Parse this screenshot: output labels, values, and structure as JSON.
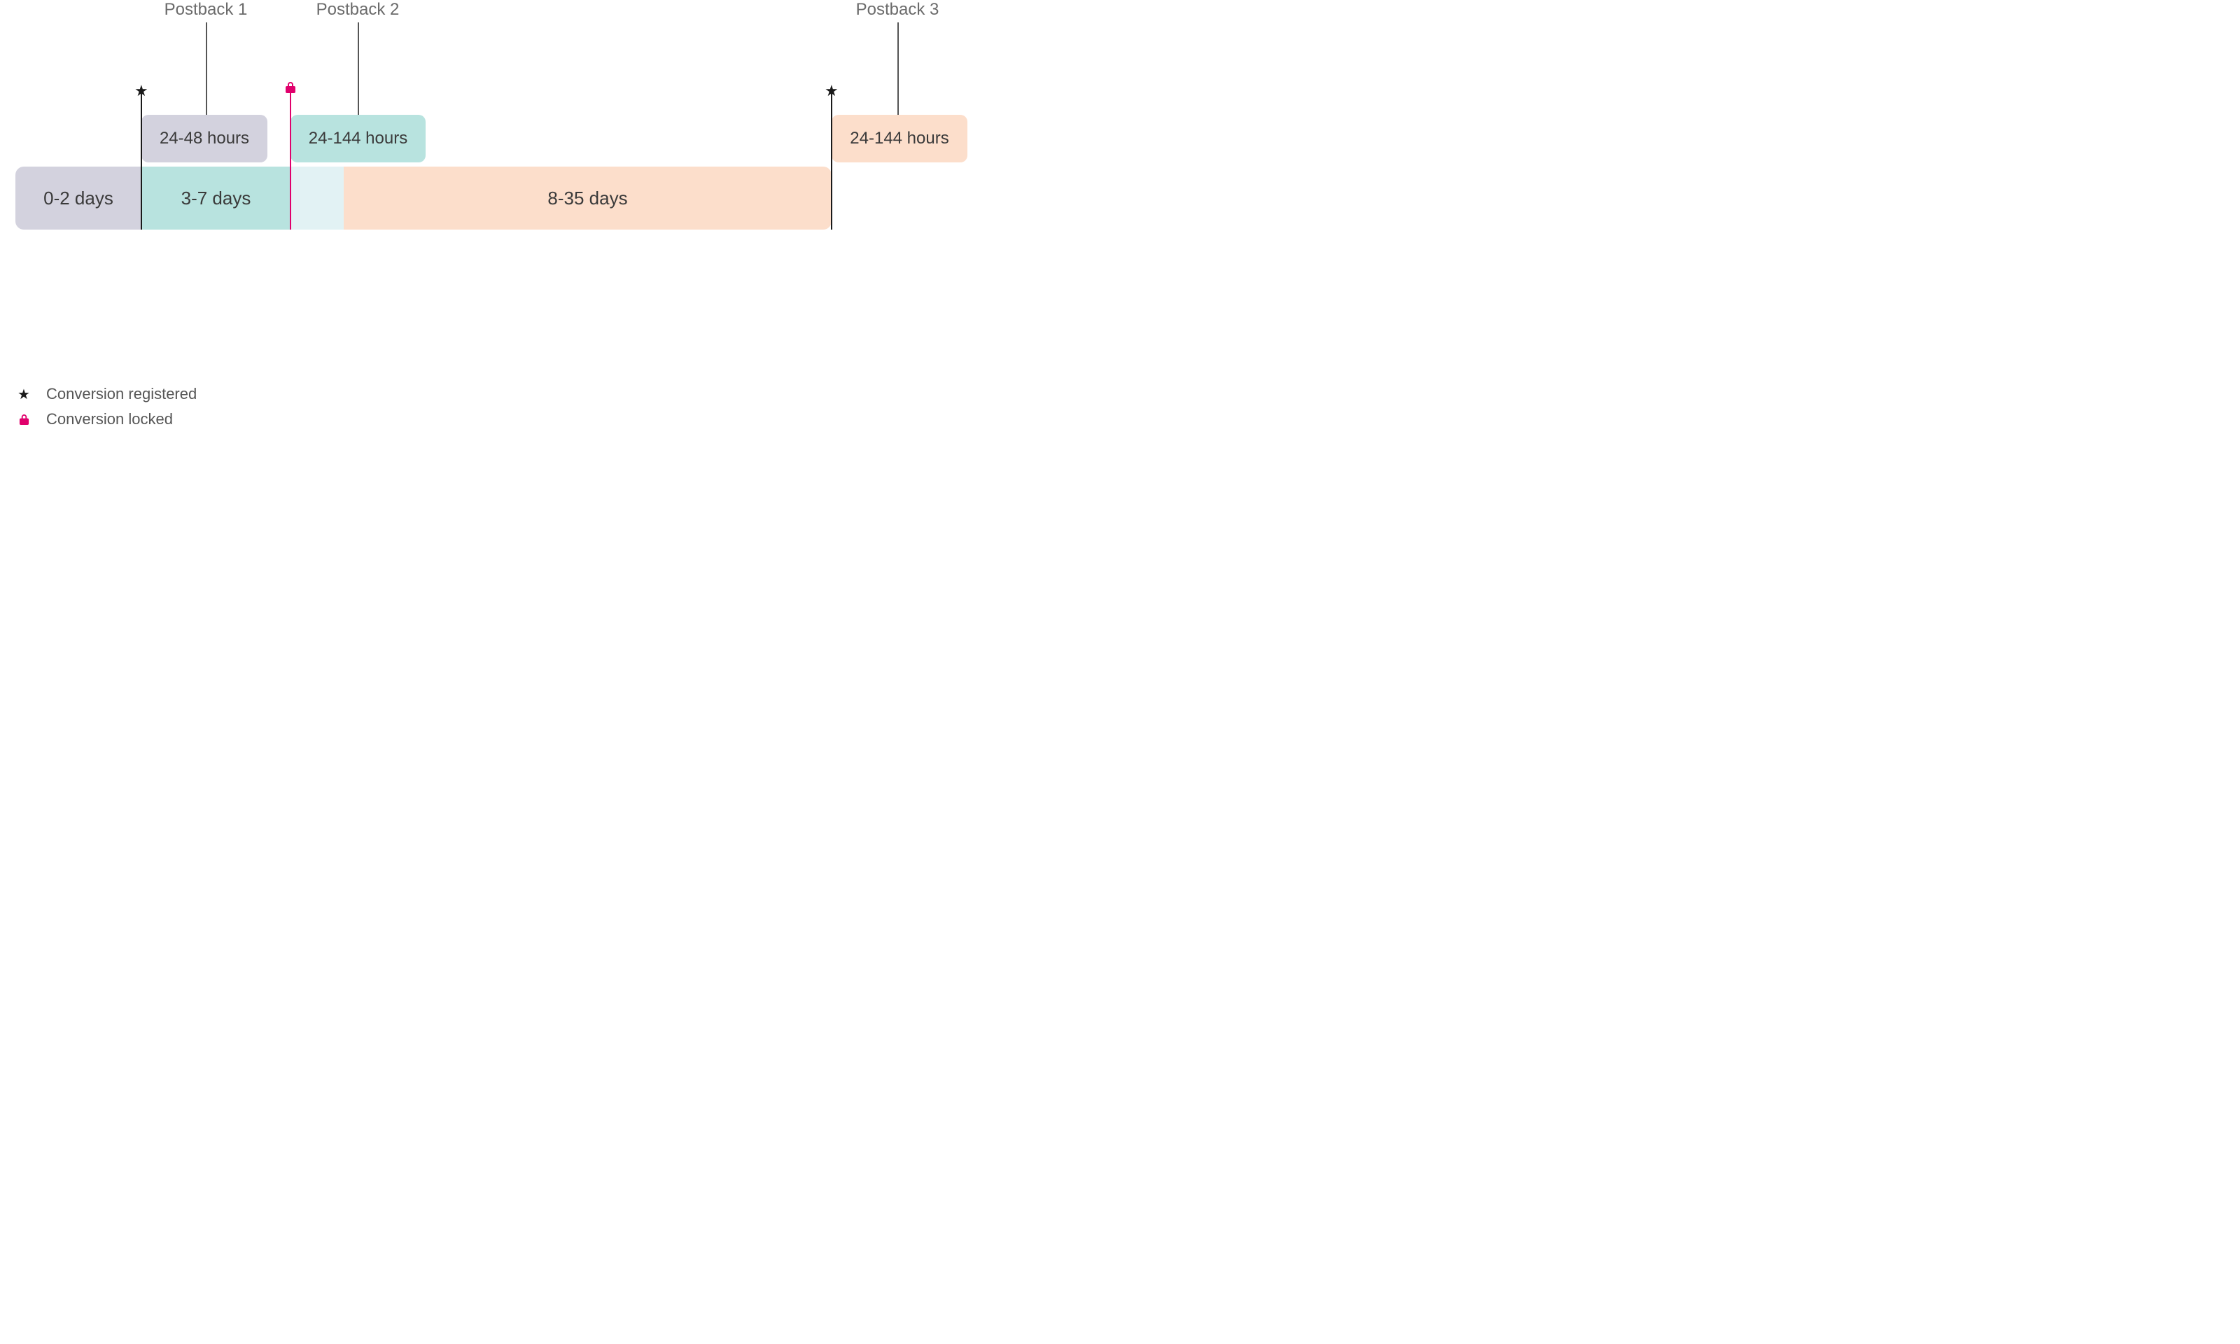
{
  "postbacks": [
    {
      "label": "Postback 1",
      "delay": "24-48 hours"
    },
    {
      "label": "Postback 2",
      "delay": "24-144 hours"
    },
    {
      "label": "Postback 3",
      "delay": "24-144 hours"
    }
  ],
  "windows": [
    {
      "label": "0-2 days"
    },
    {
      "label": "3-7 days"
    },
    {
      "label": "8-35 days"
    }
  ],
  "legend": {
    "registered": "Conversion registered",
    "locked": "Conversion locked"
  },
  "colors": {
    "lavender": "#d3d2de",
    "teal": "#b8e3df",
    "teal_light": "#e2f2f4",
    "peach": "#fcdecb",
    "pink": "#e0006c",
    "black": "#1a1a1a"
  }
}
